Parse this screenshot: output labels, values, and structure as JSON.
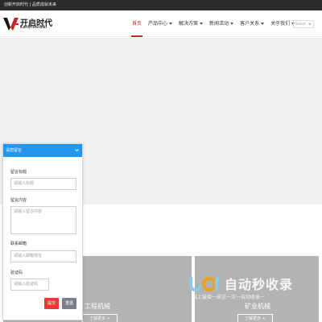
{
  "topbar": {
    "text": "创新开启时代 | 品质成就未来"
  },
  "header": {
    "logo": {
      "title": "开启时代",
      "subtitle": "KAIQISHIDAI"
    },
    "nav": [
      {
        "label": "首页",
        "active": true,
        "has_dropdown": false
      },
      {
        "label": "产品中心",
        "active": false,
        "has_dropdown": true
      },
      {
        "label": "解决方案",
        "active": false,
        "has_dropdown": true
      },
      {
        "label": "新闻活动",
        "active": false,
        "has_dropdown": true
      },
      {
        "label": "客户关系",
        "active": false,
        "has_dropdown": true
      },
      {
        "label": "关于我们",
        "active": false,
        "has_dropdown": true
      }
    ],
    "language_select": {
      "value": "Select"
    }
  },
  "colors": {
    "accent": "#c62828",
    "chat_header": "#2196f3",
    "submit": "#e53935",
    "reset": "#7a7f87",
    "card": "#b3b3b3"
  },
  "cards": [
    {
      "title": "工程机械",
      "button": "了解更多 +"
    },
    {
      "title": "矿业机械",
      "button": "了解更多 +"
    }
  ],
  "watermark": {
    "title": "自动秒收录",
    "subtitle": "做上链接一来访一次一自动收录一"
  },
  "chat": {
    "header": "请您留言",
    "toggle_icon": "chevron-down-icon",
    "fields": {
      "title_label": "留言标题",
      "title_placeholder": "请输入标题",
      "content_label": "留言内容",
      "content_placeholder": "请输入留言内容",
      "email_label": "联系邮箱",
      "email_placeholder": "请输入邮箱地址",
      "captcha_label": "验证码",
      "captcha_placeholder": "请输入验证码"
    },
    "submit_label": "提交",
    "reset_label": "重置"
  }
}
